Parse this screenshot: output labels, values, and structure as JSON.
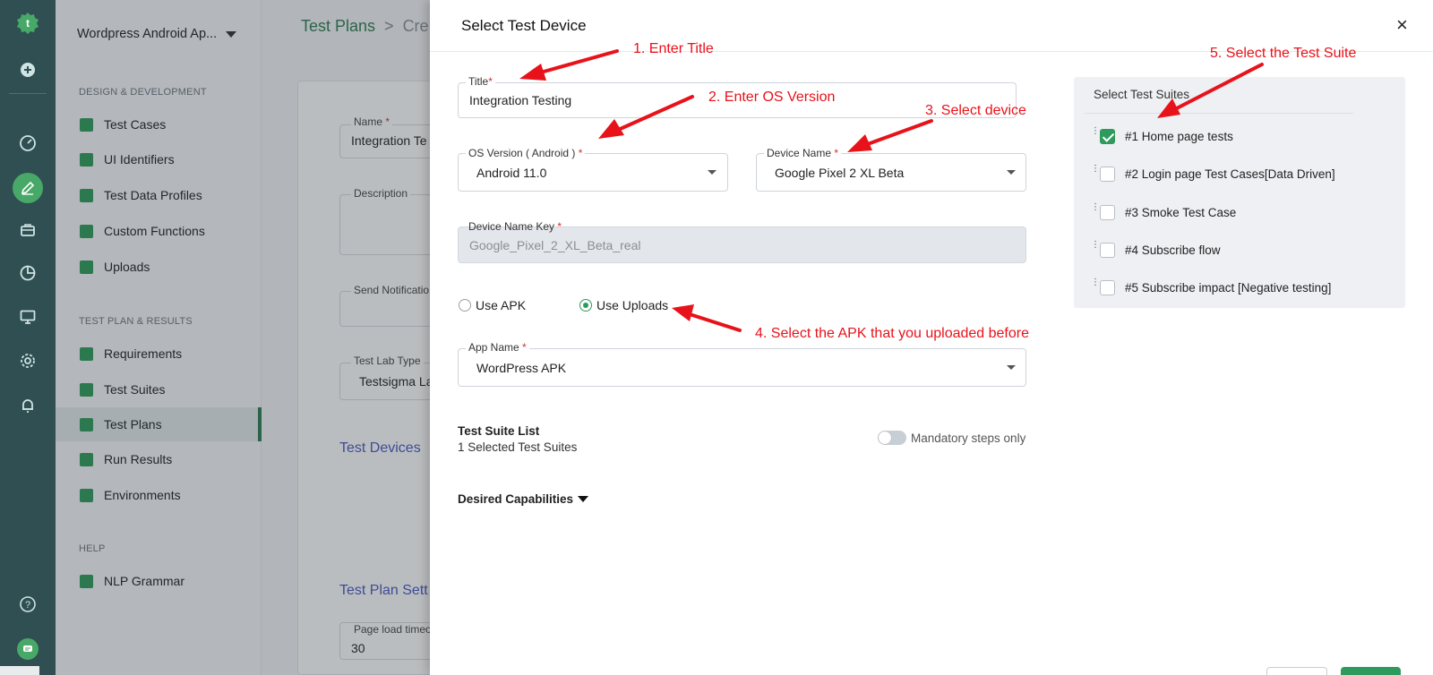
{
  "sidebar": {
    "project_name": "Wordpress Android Ap...",
    "sections": [
      {
        "title": "DESIGN & DEVELOPMENT",
        "items": [
          "Test Cases",
          "UI Identifiers",
          "Test Data Profiles",
          "Custom Functions",
          "Uploads"
        ]
      },
      {
        "title": "TEST PLAN & RESULTS",
        "items": [
          "Requirements",
          "Test Suites",
          "Test Plans",
          "Run Results",
          "Environments"
        ]
      },
      {
        "title": "HELP",
        "items": [
          "NLP Grammar"
        ]
      }
    ],
    "active_item": "Test Plans"
  },
  "background_page": {
    "breadcrumb_root": "Test Plans",
    "breadcrumb_next": "Cre",
    "name_label": "Name",
    "name_value": "Integration Te",
    "description_label": "Description",
    "send_notification_label": "Send Notificatio",
    "test_lab_type_label": "Test Lab Type",
    "test_lab_type_value": "Testsigma La",
    "test_devices_link": "Test Devices",
    "test_plan_settings_link": "Test Plan Sett",
    "page_load_label": "Page load timeo",
    "page_load_value": "30"
  },
  "modal": {
    "title": "Select Test Device",
    "close": "×",
    "title_field": {
      "label": "Title",
      "required": "*",
      "value": "Integration Testing"
    },
    "os_version": {
      "label": "OS Version ( Android )",
      "required": "*",
      "value": "Android 11.0"
    },
    "device_name": {
      "label": "Device Name",
      "required": "*",
      "value": "Google Pixel 2 XL Beta"
    },
    "device_name_key": {
      "label": "Device Name Key",
      "required": "*",
      "value": "Google_Pixel_2_XL_Beta_real"
    },
    "app_source": {
      "options": [
        "Use APK",
        "Use Uploads"
      ],
      "selected": "Use Uploads"
    },
    "app_name": {
      "label": "App Name",
      "required": "*",
      "value": "WordPress APK"
    },
    "test_suite_list": {
      "title": "Test Suite List",
      "subtitle": "1 Selected Test Suites"
    },
    "mandatory_steps": {
      "label": "Mandatory steps only",
      "on": false
    },
    "desired_capabilities": "Desired Capabilities",
    "suites_panel": {
      "title": "Select Test Suites",
      "items": [
        {
          "label": "#1  Home page tests",
          "checked": true
        },
        {
          "label": "#2  Login page Test Cases[Data Driven]",
          "checked": false
        },
        {
          "label": "#3  Smoke Test Case",
          "checked": false
        },
        {
          "label": "#4  Subscribe flow",
          "checked": false
        },
        {
          "label": "#5  Subscribe impact [Negative testing]",
          "checked": false
        }
      ]
    }
  },
  "annotations": {
    "step1": "1. Enter Title",
    "step2": "2. Enter OS Version",
    "step3": "3. Select device",
    "step4": "4. Select the APK that you uploaded before",
    "step5": "5. Select the Test Suite"
  },
  "colors": {
    "brand_green": "#2e7d52",
    "rail": "#2f4f52",
    "annotation_red": "#e8121a",
    "link_blue": "#4a57c2"
  }
}
